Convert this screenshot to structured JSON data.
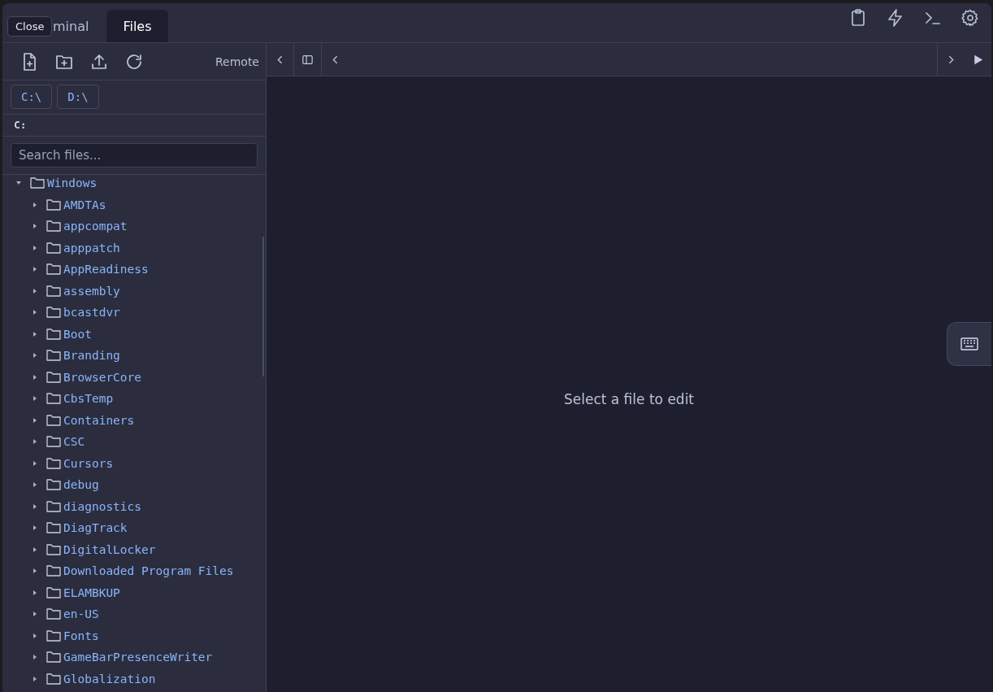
{
  "tooltip": {
    "text": "Close"
  },
  "tabs": [
    {
      "label": "minal",
      "selected": false
    },
    {
      "label": "Files",
      "selected": true
    }
  ],
  "header_icons": [
    {
      "kind": "clipboard"
    },
    {
      "kind": "bolt"
    },
    {
      "kind": "terminal"
    },
    {
      "kind": "settings"
    }
  ],
  "toolbar": {
    "actions": [
      {
        "kind": "new-file"
      },
      {
        "kind": "new-folder"
      },
      {
        "kind": "upload"
      },
      {
        "kind": "refresh"
      }
    ],
    "mode": "Remote"
  },
  "drives": [
    {
      "label": "C:\\"
    },
    {
      "label": "D:\\"
    }
  ],
  "path": "C:",
  "search": {
    "placeholder": "Search files..."
  },
  "tree": [
    {
      "name": "Windows",
      "expanded": true,
      "children": [
        {
          "name": "AMDTAs",
          "expanded": false
        },
        {
          "name": "appcompat",
          "expanded": false
        },
        {
          "name": "apppatch",
          "expanded": false
        },
        {
          "name": "AppReadiness",
          "expanded": false
        },
        {
          "name": "assembly",
          "expanded": false
        },
        {
          "name": "bcastdvr",
          "expanded": false
        },
        {
          "name": "Boot",
          "expanded": false
        },
        {
          "name": "Branding",
          "expanded": false
        },
        {
          "name": "BrowserCore",
          "expanded": false
        },
        {
          "name": "CbsTemp",
          "expanded": false
        },
        {
          "name": "Containers",
          "expanded": false
        },
        {
          "name": "CSC",
          "expanded": false
        },
        {
          "name": "Cursors",
          "expanded": false
        },
        {
          "name": "debug",
          "expanded": false
        },
        {
          "name": "diagnostics",
          "expanded": false
        },
        {
          "name": "DiagTrack",
          "expanded": false
        },
        {
          "name": "DigitalLocker",
          "expanded": false
        },
        {
          "name": "Downloaded Program Files",
          "expanded": false
        },
        {
          "name": "ELAMBKUP",
          "expanded": false
        },
        {
          "name": "en-US",
          "expanded": false
        },
        {
          "name": "Fonts",
          "expanded": false
        },
        {
          "name": "GameBarPresenceWriter",
          "expanded": false
        },
        {
          "name": "Globalization",
          "expanded": false
        }
      ]
    }
  ],
  "editor": {
    "empty_message": "Select a file to edit"
  }
}
